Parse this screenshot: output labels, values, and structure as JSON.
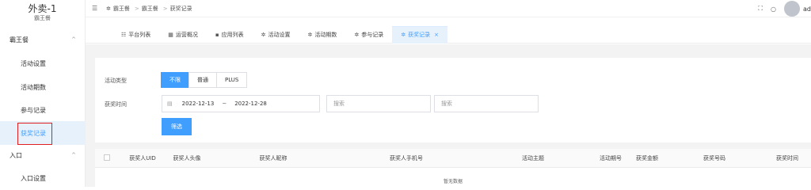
{
  "brand": {
    "title": "外卖-1",
    "subtitle": "霸王餐"
  },
  "sidebar": {
    "groups": [
      {
        "label": "霸王餐",
        "chevron": "^"
      },
      {
        "label": "入口",
        "chevron": "^"
      }
    ],
    "items": [
      {
        "label": "活动设置"
      },
      {
        "label": "活动期数"
      },
      {
        "label": "参与记录"
      },
      {
        "label": "获奖记录"
      },
      {
        "label": "入口设置"
      }
    ]
  },
  "header": {
    "breadcrumb": [
      "霸王餐",
      "霸王餐",
      "获奖记录"
    ],
    "user": "ad"
  },
  "tabs": [
    {
      "label": "平台列表",
      "icon": "list-icon"
    },
    {
      "label": "运营概况",
      "icon": "grid-icon"
    },
    {
      "label": "应用列表",
      "icon": "apps-icon"
    },
    {
      "label": "活动设置",
      "icon": "gear-icon"
    },
    {
      "label": "活动期数",
      "icon": "gear-icon"
    },
    {
      "label": "参与记录",
      "icon": "gear-icon"
    },
    {
      "label": "获奖记录",
      "icon": "gear-icon",
      "active": true
    }
  ],
  "filter": {
    "type_label": "活动类型",
    "type_options": [
      "不限",
      "普通",
      "PLUS"
    ],
    "type_selected": "不限",
    "time_label": "获奖时间",
    "date_start": "2022-12-13",
    "date_sep": "~",
    "date_end": "2022-12-28",
    "search1_placeholder": "搜索",
    "search2_placeholder": "搜索",
    "submit_label": "筛选"
  },
  "table": {
    "columns": [
      "获奖人UID",
      "获奖人头像",
      "获奖人昵称",
      "获奖人手机号",
      "活动主题",
      "活动期号",
      "获奖金额",
      "获奖号码",
      "获奖时间"
    ],
    "empty_text": "暂无数据"
  },
  "colors": {
    "primary": "#409eff",
    "highlight_border": "#e02020"
  }
}
